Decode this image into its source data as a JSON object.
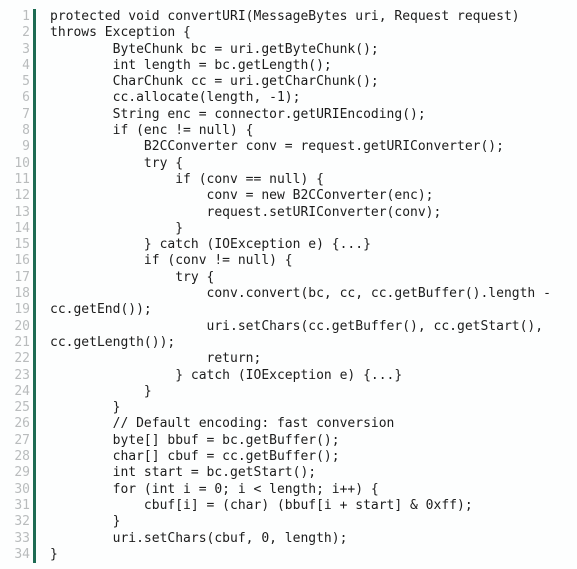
{
  "editor": {
    "language": "java",
    "background_color": "#fdfefe",
    "text_color": "#1c1c1c",
    "line_number_color": "#b9bcbd",
    "gutter_bar_color": "#1d6b53",
    "first_line": 1,
    "last_line": 34,
    "total_lines": 34
  },
  "lines": [
    {
      "number": "1",
      "text": "protected void convertURI(MessageBytes uri, Request request)"
    },
    {
      "number": "2",
      "text": "throws Exception {"
    },
    {
      "number": "3",
      "text": "        ByteChunk bc = uri.getByteChunk();"
    },
    {
      "number": "4",
      "text": "        int length = bc.getLength();"
    },
    {
      "number": "5",
      "text": "        CharChunk cc = uri.getCharChunk();"
    },
    {
      "number": "6",
      "text": "        cc.allocate(length, -1);"
    },
    {
      "number": "7",
      "text": "        String enc = connector.getURIEncoding();"
    },
    {
      "number": "8",
      "text": "        if (enc != null) {"
    },
    {
      "number": "9",
      "text": "            B2CConverter conv = request.getURIConverter();"
    },
    {
      "number": "10",
      "text": "            try {"
    },
    {
      "number": "11",
      "text": "                if (conv == null) {"
    },
    {
      "number": "12",
      "text": "                    conv = new B2CConverter(enc);"
    },
    {
      "number": "13",
      "text": "                    request.setURIConverter(conv);"
    },
    {
      "number": "14",
      "text": "                }"
    },
    {
      "number": "15",
      "text": "            } catch (IOException e) {...}"
    },
    {
      "number": "16",
      "text": "            if (conv != null) {"
    },
    {
      "number": "17",
      "text": "                try {"
    },
    {
      "number": "18",
      "text": "                    conv.convert(bc, cc, cc.getBuffer().length -"
    },
    {
      "number": "19",
      "text": "cc.getEnd());"
    },
    {
      "number": "20",
      "text": "                    uri.setChars(cc.getBuffer(), cc.getStart(),"
    },
    {
      "number": "21",
      "text": "cc.getLength());"
    },
    {
      "number": "22",
      "text": "                    return;"
    },
    {
      "number": "23",
      "text": "                } catch (IOException e) {...}"
    },
    {
      "number": "24",
      "text": "            }"
    },
    {
      "number": "25",
      "text": "        }"
    },
    {
      "number": "26",
      "text": "        // Default encoding: fast conversion"
    },
    {
      "number": "27",
      "text": "        byte[] bbuf = bc.getBuffer();"
    },
    {
      "number": "28",
      "text": "        char[] cbuf = cc.getBuffer();"
    },
    {
      "number": "29",
      "text": "        int start = bc.getStart();"
    },
    {
      "number": "30",
      "text": "        for (int i = 0; i < length; i++) {"
    },
    {
      "number": "31",
      "text": "            cbuf[i] = (char) (bbuf[i + start] & 0xff);"
    },
    {
      "number": "32",
      "text": "        }"
    },
    {
      "number": "33",
      "text": "        uri.setChars(cbuf, 0, length);"
    },
    {
      "number": "34",
      "text": "}"
    }
  ]
}
